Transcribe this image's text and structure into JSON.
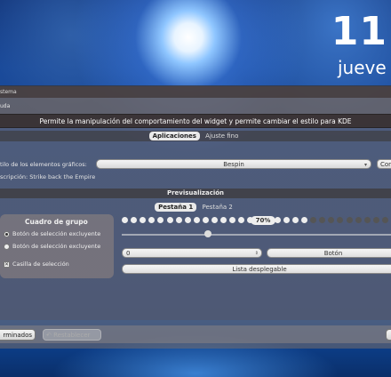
{
  "desktop": {
    "clock_day": "11",
    "clock_weekday": "juevе"
  },
  "window": {
    "title": "stema",
    "subheader": "uda",
    "banner": "Permite la manipulación del comportamiento del widget y permite cambiar el estilo para KDE",
    "tabs": [
      {
        "label": "Aplicaciones",
        "active": true
      },
      {
        "label": "Ajuste fino",
        "active": false
      }
    ],
    "style_label": "tilo de los elementos gráficos:",
    "style_value": "Bespin",
    "configure_label": "Con",
    "description": "scripción: Strike back the Empire",
    "preview_title": "Previsualización",
    "preview_tabs": [
      {
        "label": "Pestaña 1",
        "active": true
      },
      {
        "label": "Pestaña 2",
        "active": false
      }
    ],
    "group": {
      "title": "Cuadro de grupo",
      "radio1": "Botón de selección excluyente",
      "radio2": "Botón de selección excluyente",
      "checkbox": "Casilla de selección"
    },
    "progress_percent": "70%",
    "spin_value": "0",
    "button_label": "Botón",
    "dropdown_label": "Lista desplegable",
    "done_label": "rminados",
    "reset_label": "Restablecer"
  }
}
